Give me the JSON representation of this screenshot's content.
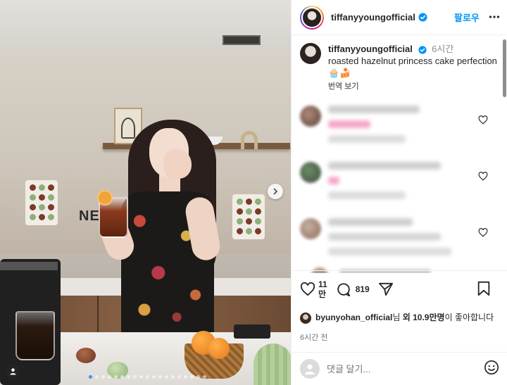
{
  "post": {
    "author": "tiffanyyoungofficial",
    "follow_label": "팔로우",
    "caption_time": "6시간",
    "caption_text": "roasted hazelnut princess cake perfection",
    "caption_emoji": "🧁🍰",
    "translate_label": "번역 보기",
    "photo_brand_text": "NE"
  },
  "actions": {
    "likes_count_top": "11",
    "likes_count_bottom": "만",
    "comments_count": "819"
  },
  "liked_by": {
    "user": "byunyohan_official",
    "suffix_1": "님 ",
    "others": "외 10.9만명",
    "suffix_2": "이 좋아합니다"
  },
  "posted_time": "6시간 전",
  "comment_input": {
    "placeholder": "댓글 달기..."
  },
  "colors": {
    "accent": "#0095f6",
    "verified": "#0095f6",
    "text": "#262626",
    "muted": "#737373"
  },
  "icons": [
    "verified-badge-icon",
    "more-icon",
    "heart-icon",
    "comment-icon",
    "share-icon",
    "bookmark-icon",
    "emoji-icon",
    "chevron-right-icon",
    "user-tag-icon"
  ]
}
